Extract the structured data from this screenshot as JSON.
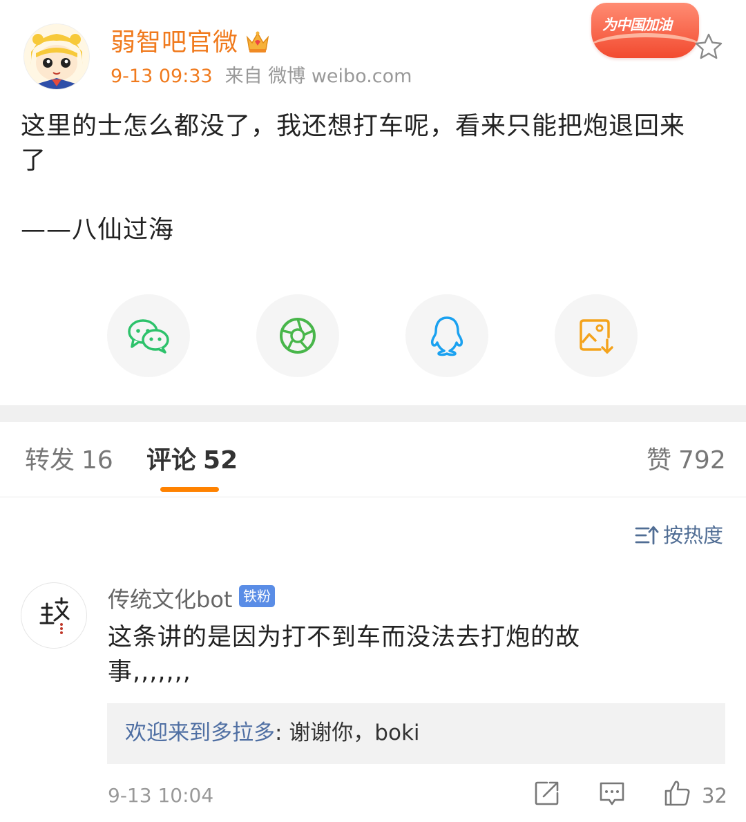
{
  "post": {
    "author": "弱智吧官微",
    "time": "9-13 09:33",
    "source": "来自 微博 weibo.com",
    "badge_text": "为中国加油",
    "text": "这里的士怎么都没了，我还想打车呢，看来只能把炮退回来\n了\n\n——八仙过海"
  },
  "share": {
    "items": [
      "wechat-icon",
      "moments-icon",
      "qq-icon",
      "save-image-icon"
    ]
  },
  "tabs": {
    "repost_label": "转发",
    "repost_count": "16",
    "comment_label": "评论",
    "comment_count": "52",
    "like_label": "赞",
    "like_count": "792"
  },
  "sort": {
    "label": "按热度"
  },
  "comment": {
    "author": "传统文化bot",
    "badge": "铁粉",
    "text": "这条讲的是因为打不到车而没法去打炮的故\n事,,,,,,,",
    "reply_author": "欢迎来到多拉多",
    "reply_sep": ": ",
    "reply_text": "谢谢你，boki",
    "time": "9-13 10:04",
    "like_count": "32"
  },
  "colors": {
    "accent": "#f07a1d",
    "tab_indicator": "#ff8200",
    "link": "#506d94",
    "fan_badge": "#5a8de6"
  }
}
